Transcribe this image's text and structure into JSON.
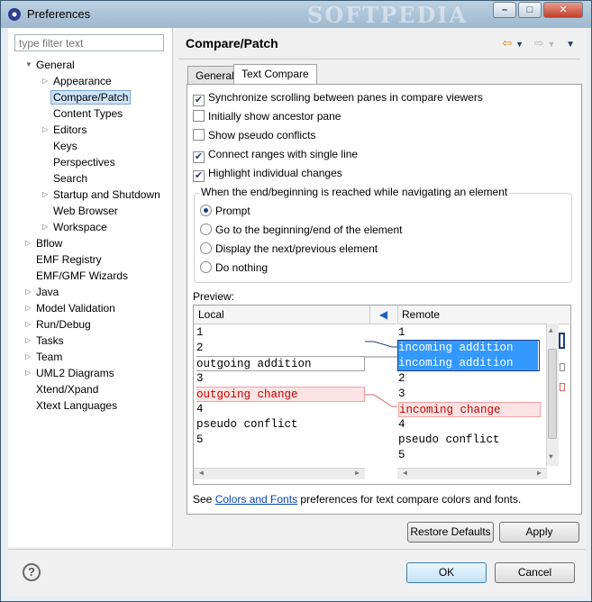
{
  "window": {
    "title": "Preferences",
    "watermark": "SOFTPEDIA"
  },
  "filter": {
    "placeholder": "type filter text"
  },
  "tree": [
    {
      "label": "General",
      "level": 0,
      "expander": "▼"
    },
    {
      "label": "Appearance",
      "level": 1,
      "expander": "▷"
    },
    {
      "label": "Compare/Patch",
      "level": 1,
      "expander": "",
      "selected": true
    },
    {
      "label": "Content Types",
      "level": 1,
      "expander": ""
    },
    {
      "label": "Editors",
      "level": 1,
      "expander": "▷"
    },
    {
      "label": "Keys",
      "level": 1,
      "expander": ""
    },
    {
      "label": "Perspectives",
      "level": 1,
      "expander": ""
    },
    {
      "label": "Search",
      "level": 1,
      "expander": ""
    },
    {
      "label": "Startup and Shutdown",
      "level": 1,
      "expander": "▷"
    },
    {
      "label": "Web Browser",
      "level": 1,
      "expander": ""
    },
    {
      "label": "Workspace",
      "level": 1,
      "expander": "▷"
    },
    {
      "label": "Bflow",
      "level": 0,
      "expander": "▷"
    },
    {
      "label": "EMF Registry",
      "level": 0,
      "expander": ""
    },
    {
      "label": "EMF/GMF Wizards",
      "level": 0,
      "expander": ""
    },
    {
      "label": "Java",
      "level": 0,
      "expander": "▷"
    },
    {
      "label": "Model Validation",
      "level": 0,
      "expander": "▷"
    },
    {
      "label": "Run/Debug",
      "level": 0,
      "expander": "▷"
    },
    {
      "label": "Tasks",
      "level": 0,
      "expander": "▷"
    },
    {
      "label": "Team",
      "level": 0,
      "expander": "▷"
    },
    {
      "label": "UML2 Diagrams",
      "level": 0,
      "expander": "▷"
    },
    {
      "label": "Xtend/Xpand",
      "level": 0,
      "expander": ""
    },
    {
      "label": "Xtext Languages",
      "level": 0,
      "expander": ""
    }
  ],
  "page": {
    "title": "Compare/Patch",
    "tabs": [
      "General",
      "Text Compare"
    ],
    "active_tab": "Text Compare"
  },
  "options": [
    {
      "label": "Synchronize scrolling between panes in compare viewers",
      "checked": true
    },
    {
      "label": "Initially show ancestor pane",
      "checked": false
    },
    {
      "label": "Show pseudo conflicts",
      "checked": false
    },
    {
      "label": "Connect ranges with single line",
      "checked": true
    },
    {
      "label": "Highlight individual changes",
      "checked": true
    }
  ],
  "navigation": {
    "group_label": "When the end/beginning is reached while navigating an element",
    "choices": [
      {
        "label": "Prompt",
        "selected": true
      },
      {
        "label": "Go to the beginning/end of the element",
        "selected": false
      },
      {
        "label": "Display the next/previous element",
        "selected": false
      },
      {
        "label": "Do nothing",
        "selected": false
      }
    ]
  },
  "preview": {
    "label": "Preview:",
    "left_title": "Local",
    "right_title": "Remote",
    "left_lines": [
      "1",
      "2",
      "outgoing addition",
      "3",
      "outgoing change",
      "4",
      "pseudo conflict",
      "5"
    ],
    "right_lines": [
      "1",
      "incoming addition",
      "incoming addition",
      "2",
      "3",
      "incoming change",
      "4",
      "pseudo conflict",
      "5"
    ]
  },
  "see_also": {
    "prefix": "See ",
    "link": "Colors and Fonts",
    "suffix": " preferences for text compare colors and fonts."
  },
  "buttons": {
    "restore": "Restore Defaults",
    "apply": "Apply",
    "ok": "OK",
    "cancel": "Cancel"
  },
  "colors": {
    "selection": "#3399ff",
    "outgoing_bg": "#fde3e3",
    "accent": "#1b3d82"
  }
}
